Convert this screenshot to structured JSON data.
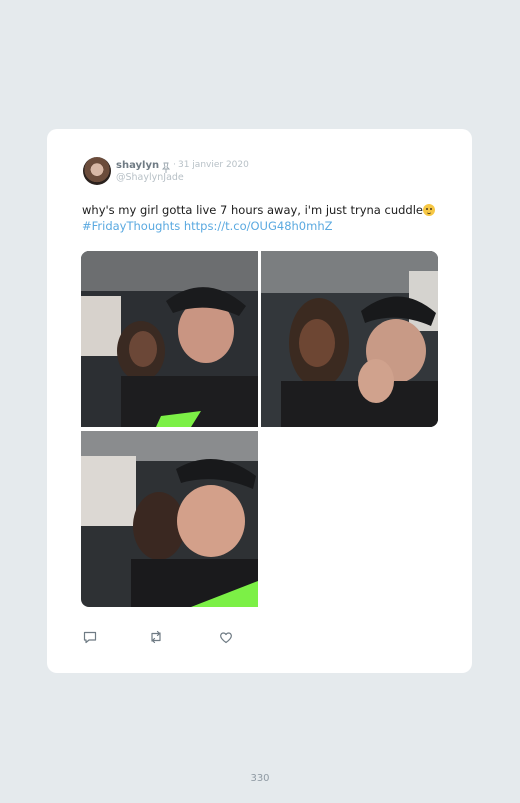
{
  "tweet": {
    "display_name": "shaylyn",
    "separator": "·",
    "date": "31 janvier 2020",
    "handle": "@ShaylynJade",
    "text": "why's my girl gotta live 7 hours away, i'm just tryna cuddle",
    "hashtag": "#FridayThoughts",
    "url": "https://t.co/OUG48h0mhZ",
    "icons": {
      "pin": "pin-icon",
      "emoji": "pleading-face-emoji",
      "reply": "reply-icon",
      "retweet": "retweet-icon",
      "like": "heart-icon"
    },
    "photos": [
      {
        "description_name": "photo-1"
      },
      {
        "description_name": "photo-2"
      },
      {
        "description_name": "photo-3"
      }
    ]
  },
  "page": {
    "number": "330"
  },
  "colors": {
    "background": "#e5eaed",
    "card": "#ffffff",
    "link": "#5aa9e0",
    "meta": "#b8c1c7",
    "name": "#6f7b84"
  }
}
